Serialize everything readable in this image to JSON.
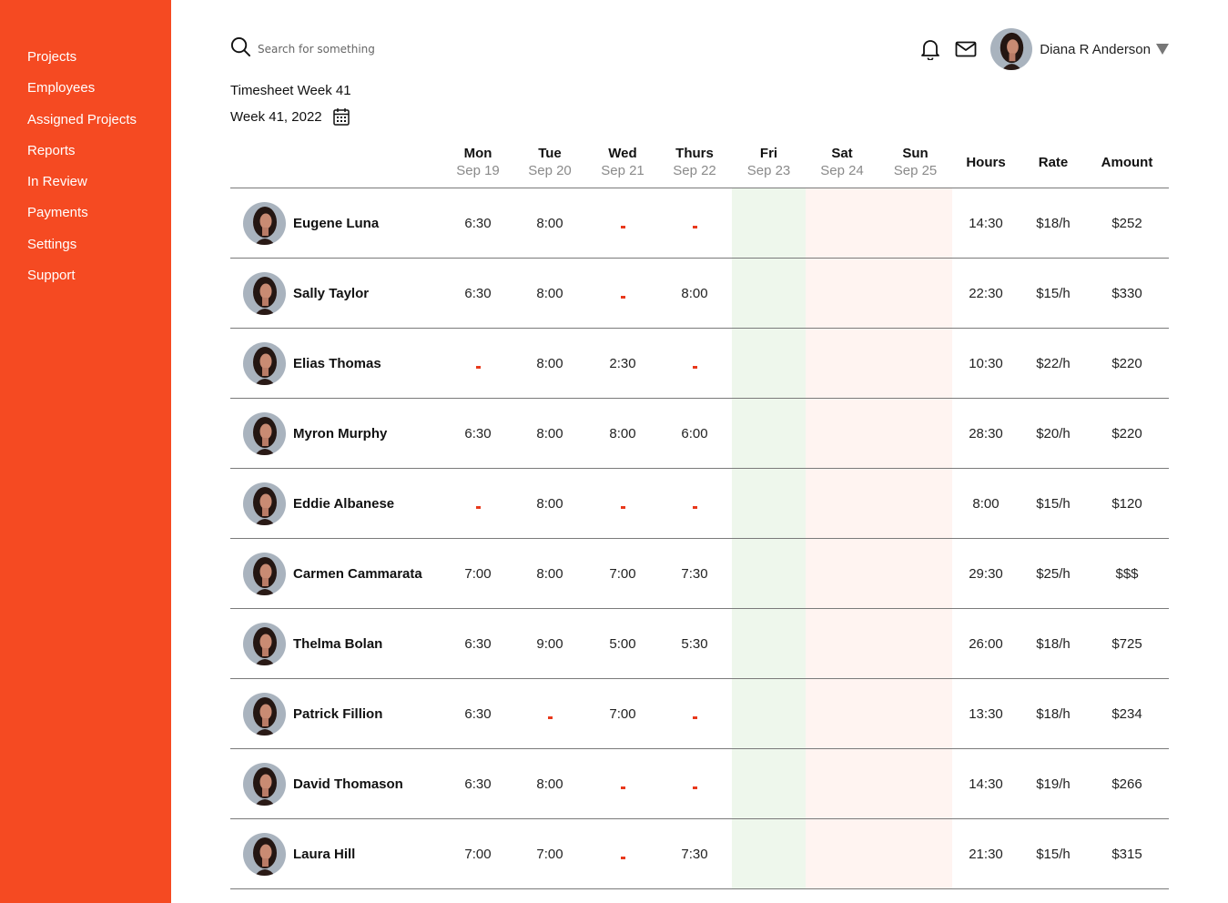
{
  "sidebar": {
    "items": [
      {
        "label": "Projects"
      },
      {
        "label": "Employees"
      },
      {
        "label": "Assigned Projects"
      },
      {
        "label": "Reports"
      },
      {
        "label": "In Review"
      },
      {
        "label": "Payments"
      },
      {
        "label": "Settings"
      },
      {
        "label": "Support"
      }
    ]
  },
  "search": {
    "placeholder": "Search for something"
  },
  "user": {
    "name": "Diana R Anderson"
  },
  "sheet": {
    "title": "Timesheet Week 41",
    "week": "Week 41, 2022"
  },
  "colors": {
    "accent": "#f54a22",
    "dash": "#e8391c",
    "friday_band": "#eef7ec",
    "weekend_band": "#fff4f1"
  },
  "columns": {
    "days": [
      {
        "day": "Mon",
        "date": "Sep 19"
      },
      {
        "day": "Tue",
        "date": "Sep 20"
      },
      {
        "day": "Wed",
        "date": "Sep 21"
      },
      {
        "day": "Thurs",
        "date": "Sep 22"
      },
      {
        "day": "Fri",
        "date": "Sep 23"
      },
      {
        "day": "Sat",
        "date": "Sep 24"
      },
      {
        "day": "Sun",
        "date": "Sep 25"
      }
    ],
    "hours": "Hours",
    "rate": "Rate",
    "amount": "Amount"
  },
  "rows": [
    {
      "name": "Eugene Luna",
      "mon": "6:30",
      "tue": "8:00",
      "wed": "-",
      "thu": "-",
      "hours": "14:30",
      "rate": "$18/h",
      "amount": "$252"
    },
    {
      "name": "Sally Taylor",
      "mon": "6:30",
      "tue": "8:00",
      "wed": "-",
      "thu": "8:00",
      "hours": "22:30",
      "rate": "$15/h",
      "amount": "$330"
    },
    {
      "name": "Elias Thomas",
      "mon": "-",
      "tue": "8:00",
      "wed": "2:30",
      "thu": "-",
      "hours": "10:30",
      "rate": "$22/h",
      "amount": "$220"
    },
    {
      "name": "Myron Murphy",
      "mon": "6:30",
      "tue": "8:00",
      "wed": "8:00",
      "thu": "6:00",
      "hours": "28:30",
      "rate": "$20/h",
      "amount": "$220"
    },
    {
      "name": "Eddie Albanese",
      "mon": "-",
      "tue": "8:00",
      "wed": "-",
      "thu": "-",
      "hours": "8:00",
      "rate": "$15/h",
      "amount": "$120"
    },
    {
      "name": "Carmen Cammarata",
      "mon": "7:00",
      "tue": "8:00",
      "wed": "7:00",
      "thu": "7:30",
      "hours": "29:30",
      "rate": "$25/h",
      "amount": "$$$"
    },
    {
      "name": "Thelma Bolan",
      "mon": "6:30",
      "tue": "9:00",
      "wed": "5:00",
      "thu": "5:30",
      "hours": "26:00",
      "rate": "$18/h",
      "amount": "$725"
    },
    {
      "name": "Patrick Fillion",
      "mon": "6:30",
      "tue": "-",
      "wed": "7:00",
      "thu": "-",
      "hours": "13:30",
      "rate": "$18/h",
      "amount": "$234"
    },
    {
      "name": "David Thomason",
      "mon": "6:30",
      "tue": "8:00",
      "wed": "-",
      "thu": "-",
      "hours": "14:30",
      "rate": "$19/h",
      "amount": "$266"
    },
    {
      "name": "Laura Hill",
      "mon": "7:00",
      "tue": "7:00",
      "wed": "-",
      "thu": "7:30",
      "hours": "21:30",
      "rate": "$15/h",
      "amount": "$315"
    }
  ]
}
